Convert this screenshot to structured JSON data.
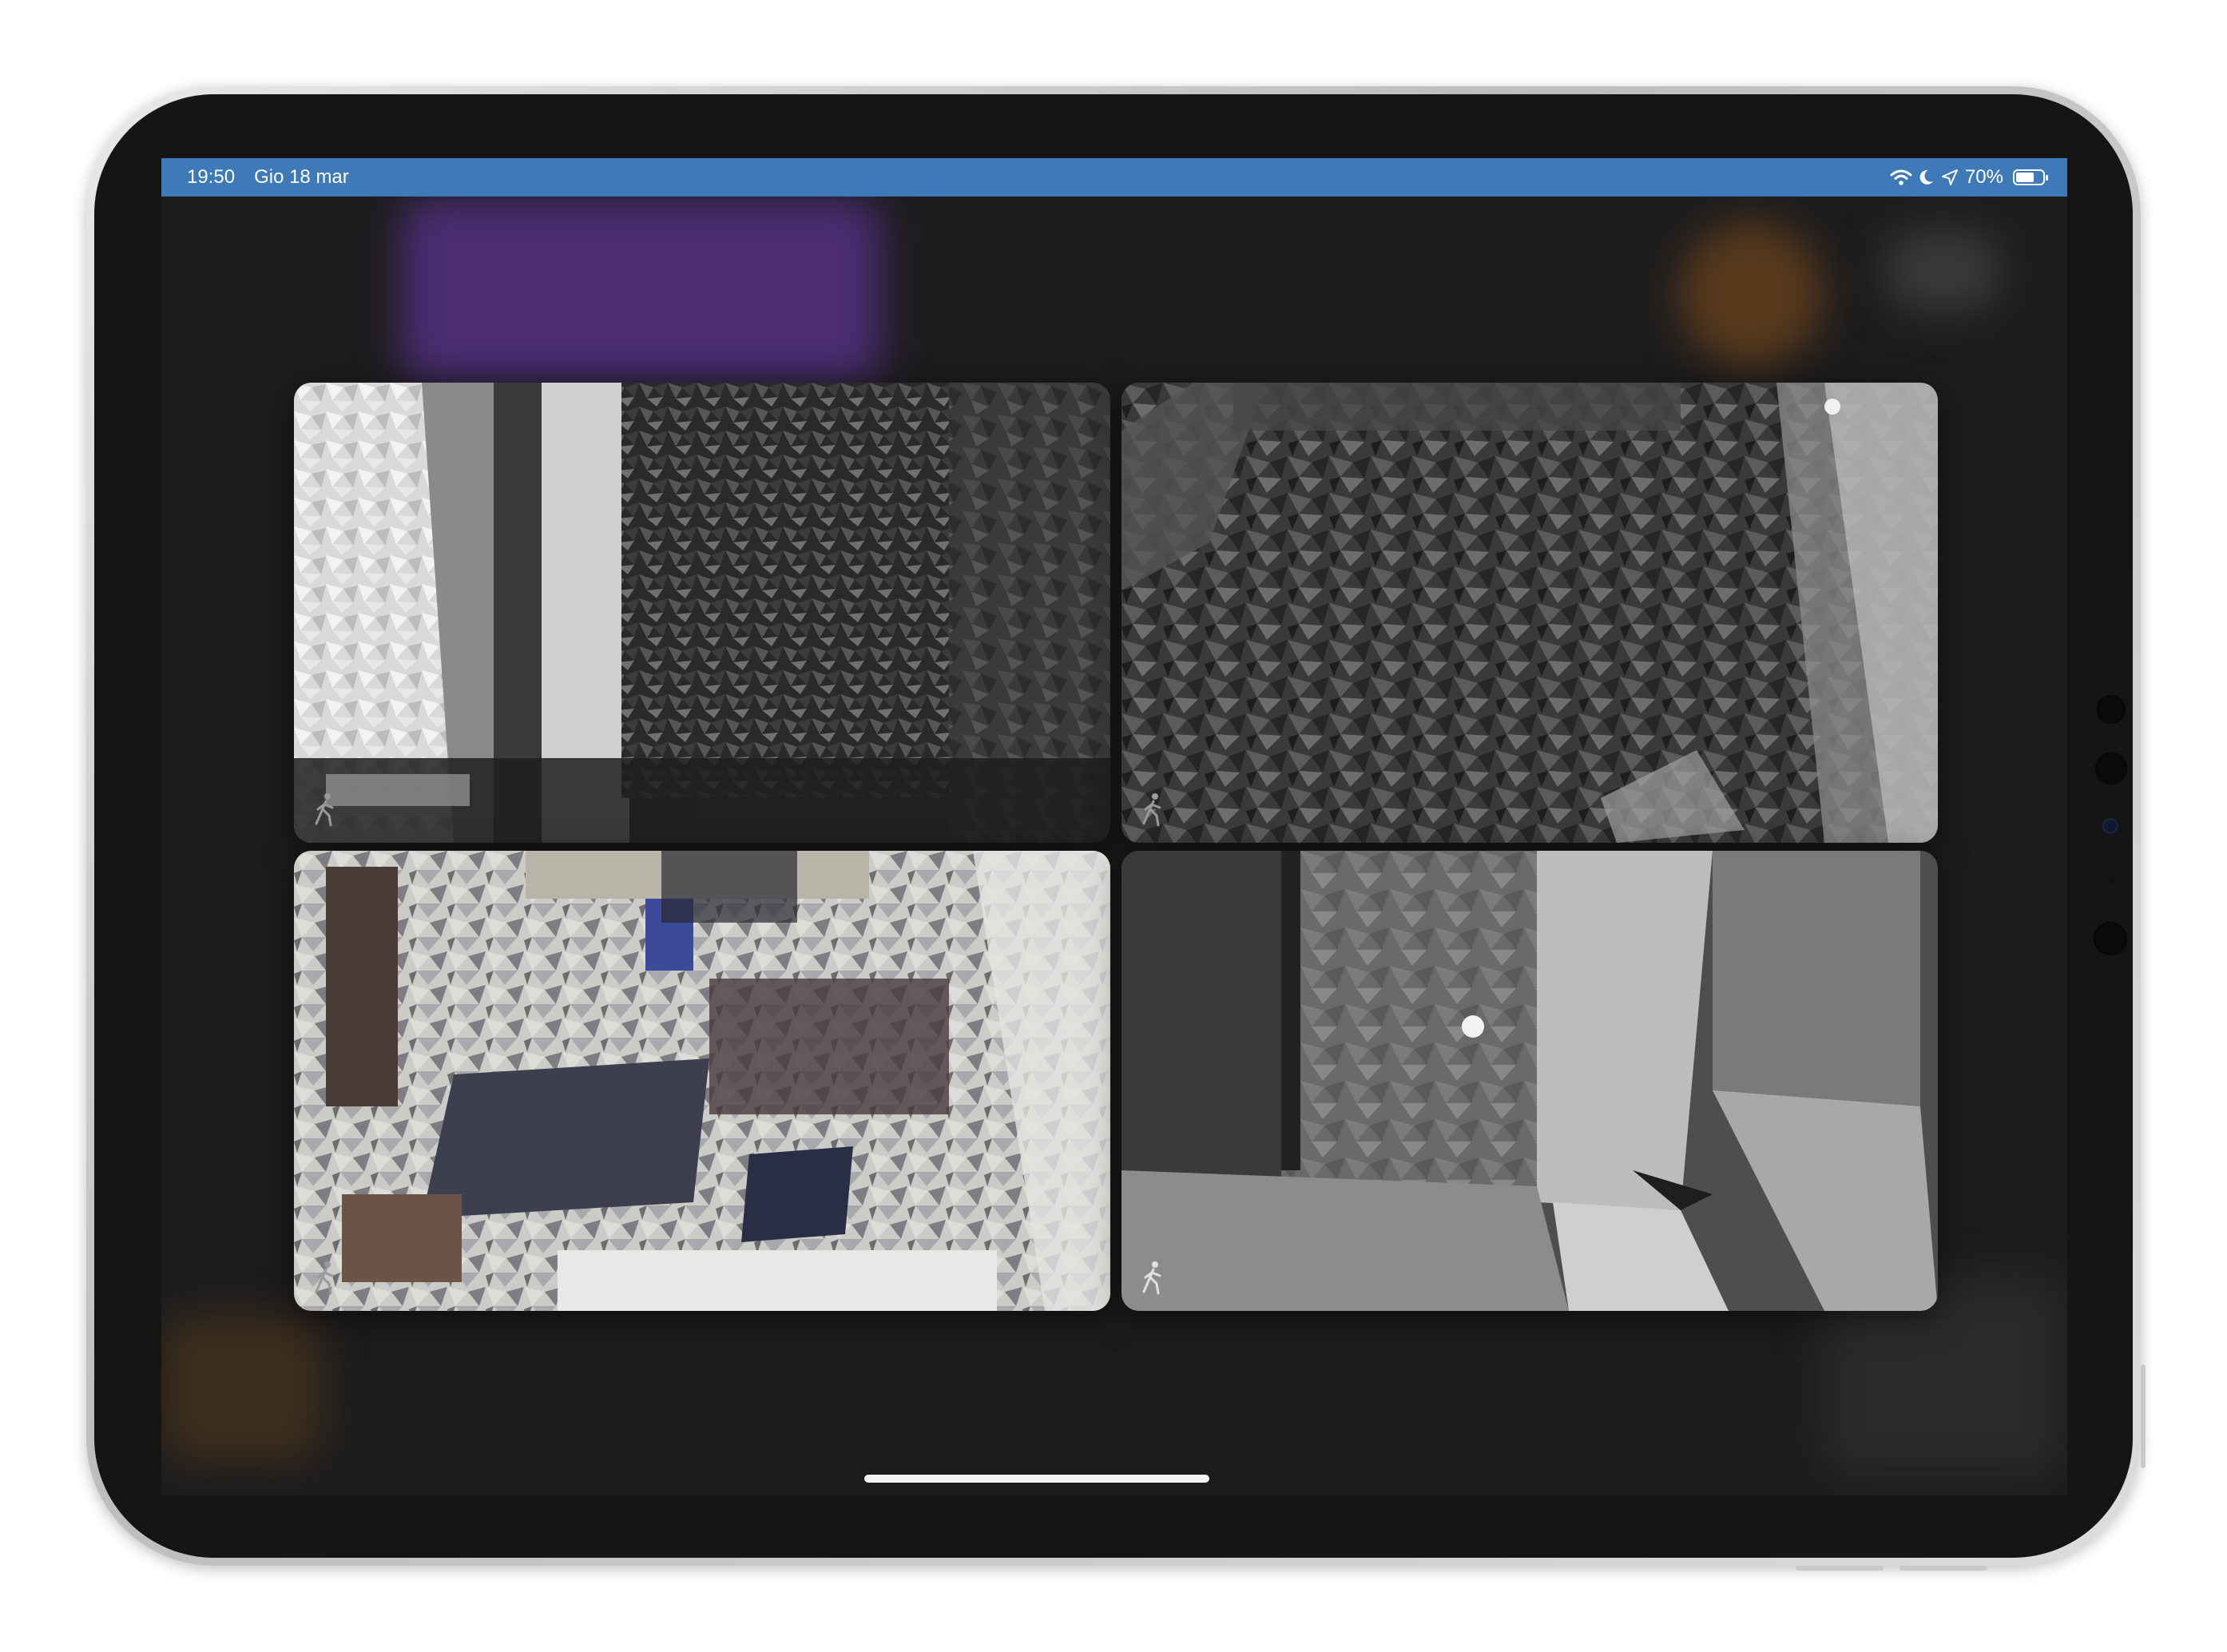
{
  "status_bar": {
    "time": "19:50",
    "date": "Gio 18 mar",
    "battery_text": "70%",
    "battery_level": 0.7,
    "icons": [
      "wifi-icon",
      "moon-icon",
      "location-arrow-icon",
      "battery-icon"
    ],
    "background_color": "#3d7ab7"
  },
  "cameras": [
    {
      "id": "camera-1",
      "style": "night-vision-grayscale",
      "badge_icon": "motion-person-icon"
    },
    {
      "id": "camera-2",
      "style": "night-vision-grayscale",
      "badge_icon": "motion-person-icon"
    },
    {
      "id": "camera-3",
      "style": "color",
      "badge_icon": "motion-person-icon"
    },
    {
      "id": "camera-4",
      "style": "night-vision-grayscale",
      "badge_icon": "motion-person-icon"
    }
  ],
  "device": {
    "frame_color": "#d2d2d4",
    "bezel_color": "#151515"
  }
}
